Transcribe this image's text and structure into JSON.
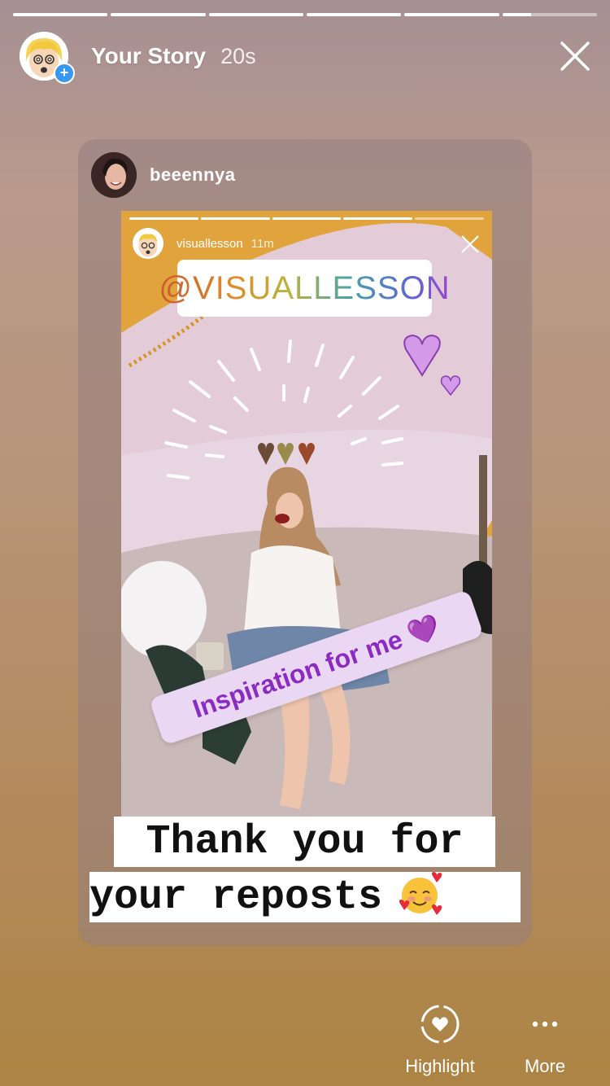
{
  "progress": [
    1,
    1,
    1,
    1,
    1,
    0.3
  ],
  "header": {
    "title": "Your Story",
    "time": "20s"
  },
  "repost": {
    "username": "beeennya",
    "inner": {
      "progress": [
        1,
        1,
        1,
        1,
        0
      ],
      "username": "visuallesson",
      "time": "11m",
      "mention": "@VISUALLESSON",
      "sticker_text": "Inspiration for me 💜",
      "caption_line1": "Thank you for",
      "caption_line2": "your reposts"
    }
  },
  "actions": {
    "highlight_label": "Highlight",
    "more_label": "More"
  },
  "colors": {
    "accent": "#3897f0",
    "sticker_text": "#8a2bc2",
    "sticker_bg": "#ead7f3"
  }
}
